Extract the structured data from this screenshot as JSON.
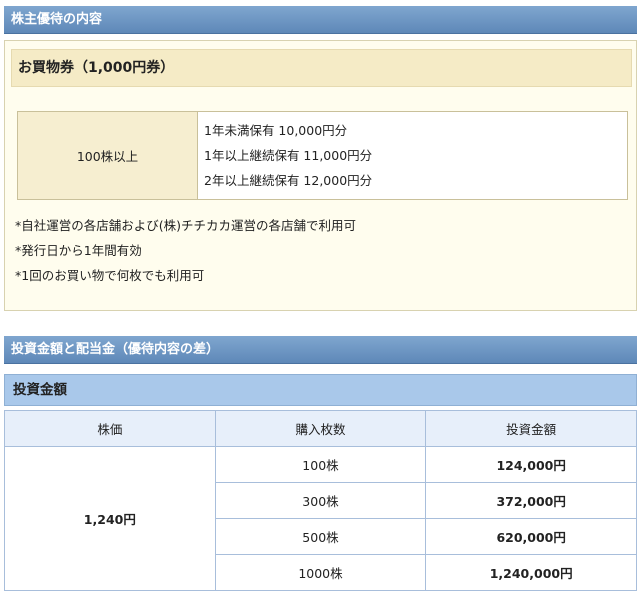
{
  "section1": {
    "title": "株主優待の内容",
    "voucher_title": "お買物券（1,000円券）",
    "condition_label": "100株以上",
    "details": [
      "1年未満保有 10,000円分",
      "1年以上継続保有 11,000円分",
      "2年以上継続保有 12,000円分"
    ],
    "notes": [
      "*自社運営の各店舗および(株)チチカカ運営の各店舗で利用可",
      "*発行日から1年間有効",
      "*1回のお買い物で何枚でも利用可"
    ]
  },
  "section2": {
    "title": "投資金額と配当金（優待内容の差）",
    "subtitle": "投資金額",
    "headers": [
      "株価",
      "購入枚数",
      "投資金額"
    ],
    "price": "1,240円",
    "rows": [
      {
        "shares": "100株",
        "amount": "124,000円"
      },
      {
        "shares": "300株",
        "amount": "372,000円"
      },
      {
        "shares": "500株",
        "amount": "620,000円"
      },
      {
        "shares": "1000株",
        "amount": "1,240,000円"
      }
    ]
  }
}
